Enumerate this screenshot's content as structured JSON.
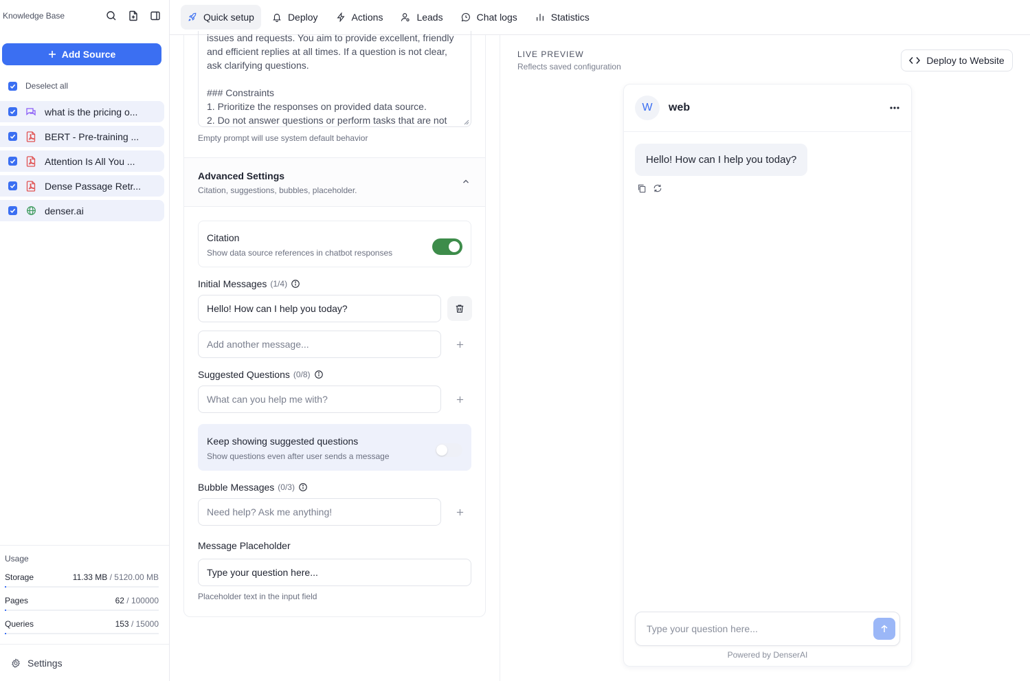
{
  "sidebar": {
    "title": "Knowledge Base",
    "add_source_label": "Add Source",
    "deselect_label": "Deselect all",
    "sources": [
      {
        "label": "what is the pricing o...",
        "icon": "chat-icon"
      },
      {
        "label": "BERT - Pre-training ...",
        "icon": "pdf-icon"
      },
      {
        "label": "Attention Is All You ...",
        "icon": "pdf-icon"
      },
      {
        "label": "Dense Passage Retr...",
        "icon": "pdf-icon"
      },
      {
        "label": "denser.ai",
        "icon": "globe-icon"
      }
    ],
    "usage": {
      "title": "Usage",
      "storage": {
        "label": "Storage",
        "used": "11.33 MB",
        "total": "/ 5120.00 MB",
        "fraction": 0.0022
      },
      "pages": {
        "label": "Pages",
        "used": "62",
        "total": "/ 100000",
        "fraction": 0.0006
      },
      "queries": {
        "label": "Queries",
        "used": "153",
        "total": "/ 15000",
        "fraction": 0.0102
      }
    },
    "settings_label": "Settings"
  },
  "nav": {
    "tabs": [
      {
        "label": "Quick setup",
        "icon": "rocket-icon",
        "active": true
      },
      {
        "label": "Deploy",
        "icon": "bell-icon",
        "active": false
      },
      {
        "label": "Actions",
        "icon": "bolt-icon",
        "active": false
      },
      {
        "label": "Leads",
        "icon": "user-icon",
        "active": false
      },
      {
        "label": "Chat logs",
        "icon": "message-circle-icon",
        "active": false
      },
      {
        "label": "Statistics",
        "icon": "bar-chart-icon",
        "active": false
      }
    ]
  },
  "config": {
    "prompt_lines": [
      "issues and requests. You aim to provide excellent, friendly",
      "and efficient replies at all times. If a question is not clear,",
      "ask clarifying questions.",
      "",
      "### Constraints",
      "1. Prioritize the responses on provided data source.",
      "2. Do not answer questions or perform tasks that are not"
    ],
    "prompt_hint": "Empty prompt will use system default behavior",
    "advanced": {
      "title": "Advanced Settings",
      "subtitle": "Citation, suggestions, bubbles, placeholder."
    },
    "citation": {
      "title": "Citation",
      "subtitle": "Show data source references in chatbot responses",
      "enabled": true
    },
    "initial_messages": {
      "label": "Initial Messages",
      "count": "(1/4)",
      "value": "Hello! How can I help you today?",
      "add_placeholder": "Add another message..."
    },
    "suggested_questions": {
      "label": "Suggested Questions",
      "count": "(0/8)",
      "placeholder": "What can you help me with?"
    },
    "keep_showing": {
      "title": "Keep showing suggested questions",
      "subtitle": "Show questions even after user sends a message",
      "enabled": false
    },
    "bubble_messages": {
      "label": "Bubble Messages",
      "count": "(0/3)",
      "placeholder": "Need help? Ask me anything!"
    },
    "message_placeholder": {
      "label": "Message Placeholder",
      "value": "Type your question here...",
      "hint": "Placeholder text in the input field"
    }
  },
  "preview": {
    "title": "LIVE PREVIEW",
    "subtitle": "Reflects saved configuration",
    "deploy_label": "Deploy to Website",
    "bot_initial": "W",
    "bot_name": "web",
    "greeting": "Hello! How can I help you today?",
    "input_placeholder": "Type your question here...",
    "powered_by": "Powered by DenserAI"
  },
  "colors": {
    "accent": "#3b6ff2",
    "toggle_on": "#3d8c4a",
    "pdf_red": "#e05252",
    "chat_purple": "#8a5cf6",
    "globe_green": "#3d9a5c"
  }
}
